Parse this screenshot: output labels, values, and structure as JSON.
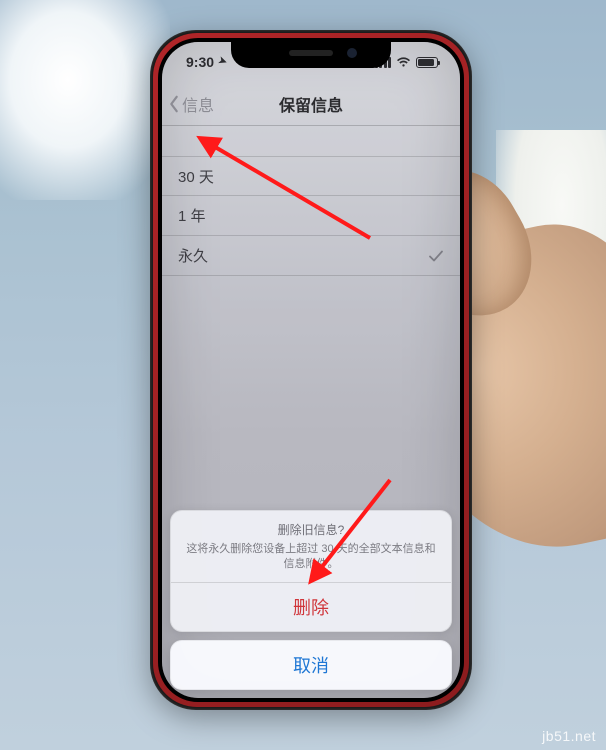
{
  "status": {
    "time": "9:30",
    "location_arrow": "➤"
  },
  "nav": {
    "back_label": "信息",
    "title": "保留信息"
  },
  "options": [
    {
      "label": "30 天",
      "selected": false
    },
    {
      "label": "1 年",
      "selected": false
    },
    {
      "label": "永久",
      "selected": true
    }
  ],
  "sheet": {
    "title": "删除旧信息?",
    "message": "这将永久删除您设备上超过 30 天的全部文本信息和信息附件。",
    "delete_label": "删除",
    "cancel_label": "取消"
  },
  "colors": {
    "destructive": "#d0353a",
    "link": "#1f77d4",
    "annotation": "#ff1a1a"
  },
  "watermark": "jb51.net"
}
